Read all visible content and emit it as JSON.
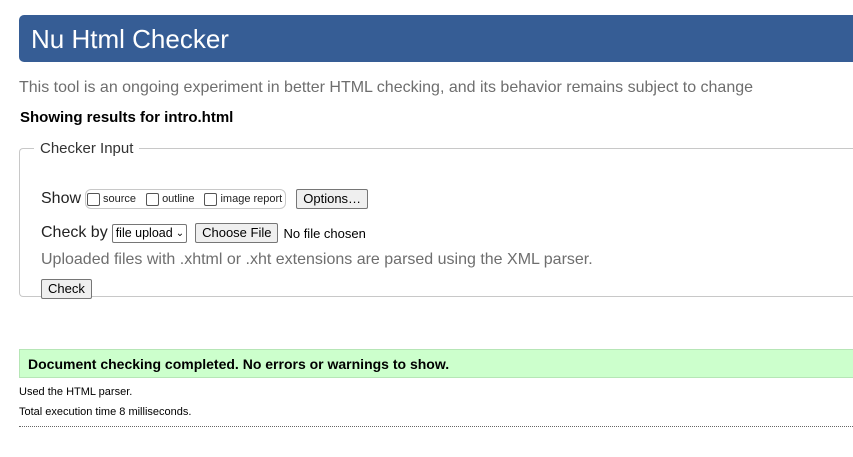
{
  "header": {
    "title": "Nu Html Checker"
  },
  "intro": "This tool is an ongoing experiment in better HTML checking, and its behavior remains subject to change",
  "results_for": "Showing results for intro.html",
  "checker_input": {
    "legend": "Checker Input",
    "show_label": "Show",
    "show_options": [
      {
        "label": "source",
        "checked": false
      },
      {
        "label": "outline",
        "checked": false
      },
      {
        "label": "image report",
        "checked": false
      }
    ],
    "options_button": "Options…",
    "check_by_label": "Check by",
    "check_by_selected": "file upload",
    "choose_file_button": "Choose File",
    "file_status": "No file chosen",
    "note": "Uploaded files with .xhtml or .xht extensions are parsed using the XML parser.",
    "check_button": "Check"
  },
  "result": {
    "message": "Document checking completed. No errors or warnings to show.",
    "parser": "Used the HTML parser.",
    "execution_time": "Total execution time 8 milliseconds."
  },
  "colors": {
    "header_bg": "#365d95",
    "success_bg": "#ccffcc"
  }
}
